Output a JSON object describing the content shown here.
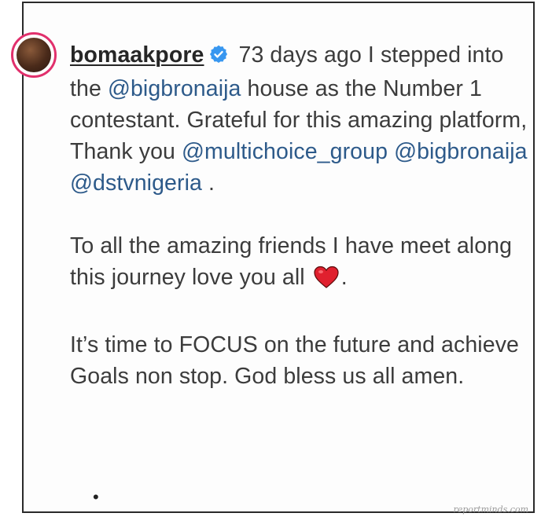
{
  "post": {
    "username": "bomaakpore",
    "caption_line1_text": " 73 days ago I stepped into the ",
    "mention_bigbronaija": "@bigbronaija",
    "caption_line1_text2": " house as the Number 1 contestant. Grateful for this amazing platform, Thank you ",
    "mention_multichoice": "@multichoice_group",
    "space_between": " ",
    "mention_bigbronaija_2": "@bigbronaija",
    "mention_dstv": "@dstvnigeria",
    "caption_line1_end": " .",
    "para2_text": "To all the amazing friends I have meet along this journey love you all ",
    "para2_end": ".",
    "para3_text": "It’s time to FOCUS on the future and achieve Goals non stop. God bless us all amen.",
    "bullet": "•",
    "watermark": "reportminds.com"
  },
  "colors": {
    "avatar_ring": "#e1306c",
    "verified_badge": "#3897f0",
    "mention": "#2d5a8a",
    "text": "#3c3c3c",
    "heart": "#e0202e"
  },
  "icons": {
    "verified": "verified-badge-icon",
    "heart": "red-heart-emoji-icon"
  }
}
